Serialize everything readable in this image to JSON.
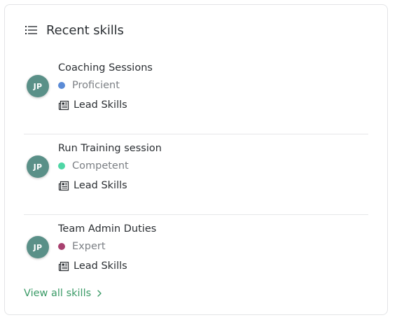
{
  "card": {
    "title": "Recent skills",
    "title_icon": "list-icon",
    "view_all_label": "View all skills",
    "view_all_icon": "chevron-right-icon"
  },
  "skills": [
    {
      "avatar_initials": "JP",
      "name": "Coaching Sessions",
      "level": "Proficient",
      "level_color": "#5b8bd6",
      "category": "Lead Skills",
      "category_icon": "news-icon"
    },
    {
      "avatar_initials": "JP",
      "name": "Run Training session",
      "level": "Competent",
      "level_color": "#4fd6a5",
      "category": "Lead Skills",
      "category_icon": "news-icon"
    },
    {
      "avatar_initials": "JP",
      "name": "Team Admin Duties",
      "level": "Expert",
      "level_color": "#a8416f",
      "category": "Lead Skills",
      "category_icon": "news-icon"
    }
  ],
  "colors": {
    "avatar_bg": "#5a9088",
    "link": "#3a9a66"
  }
}
